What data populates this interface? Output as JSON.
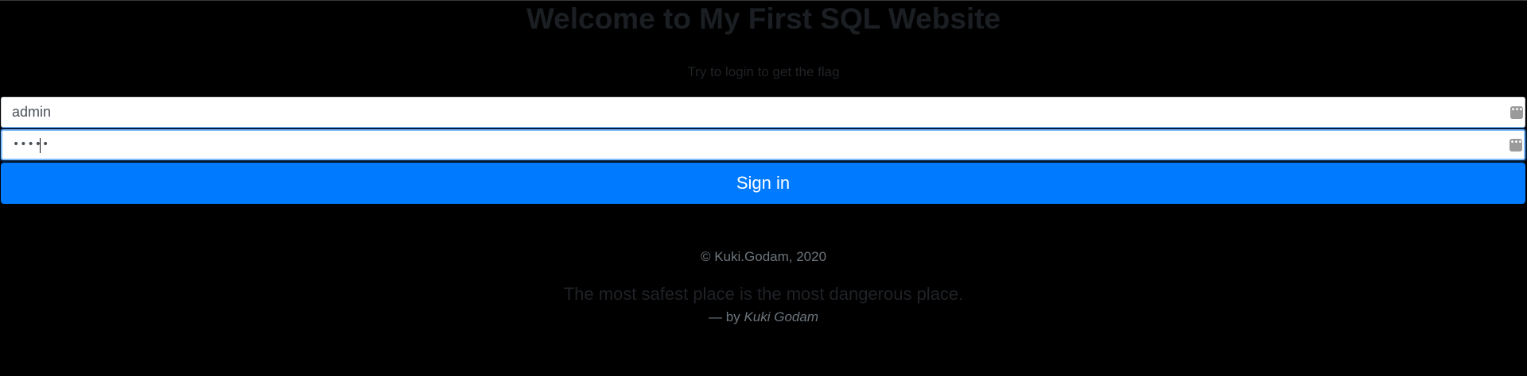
{
  "page": {
    "title": "Welcome to My First SQL Website",
    "subtitle": "Try to login to get the flag"
  },
  "login_form": {
    "username_value": "admin",
    "password_mask": "•••••",
    "field_icon": "ellipsis-icon",
    "field_icon_glyph": "•••",
    "signin_label": "Sign in"
  },
  "footer": {
    "copyright": "© Kuki.Godam, 2020",
    "quote": "The most safest place is the most dangerous place.",
    "quote_by_prefix": "— by",
    "quote_author": "Kuki Godam"
  },
  "colors": {
    "background": "#000000",
    "primary_button": "#007bff",
    "input_background": "#ffffff",
    "focus_border": "#80bdff",
    "muted_text": "#6c757d"
  }
}
